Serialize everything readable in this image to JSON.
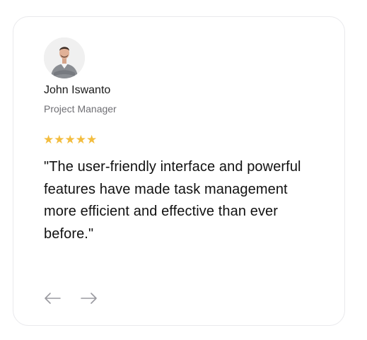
{
  "testimonial": {
    "author_name": "John Iswanto",
    "author_role": "Project Manager",
    "rating": 5,
    "rating_max": 5,
    "stars": [
      "★",
      "★",
      "★",
      "★",
      "★"
    ],
    "quote": "\"The user-friendly interface and powerful features have made task management more efficient and effective than ever before.\"",
    "star_color": "#f3bd3f"
  },
  "navigation": {
    "prev_icon": "arrow-left-icon",
    "next_icon": "arrow-right-icon"
  }
}
